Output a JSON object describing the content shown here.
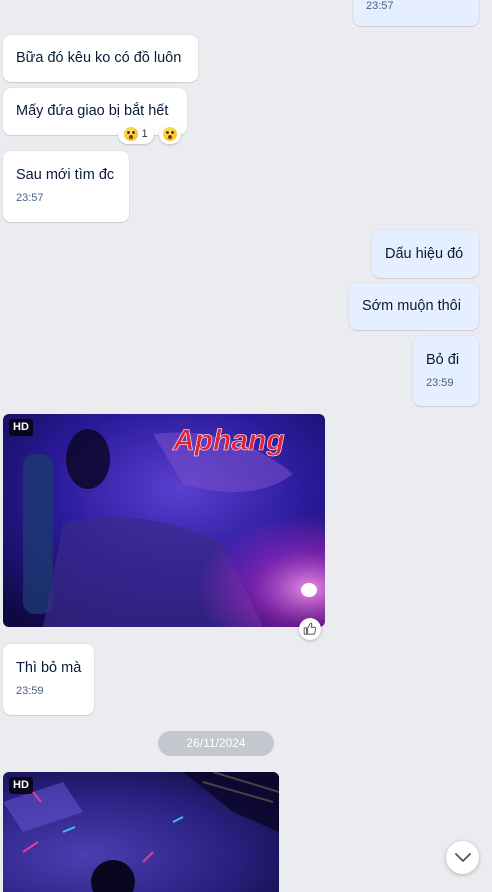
{
  "messages": {
    "m0": {
      "time": "23:57"
    },
    "m1": {
      "text": "Bữa đó kêu ko có đồ luôn"
    },
    "m2": {
      "text": "Mấy đứa giao bị bắt hết",
      "reaction_count": "1"
    },
    "m3": {
      "text": "Sau mới tìm đc",
      "time": "23:57"
    },
    "m4": {
      "text": "Dấu hiệu đó"
    },
    "m5": {
      "text": "Sớm muộn thôi"
    },
    "m6": {
      "text": "Bỏ đi",
      "time": "23:59"
    },
    "m7": {
      "badge": "HD",
      "watermark": "Aphang"
    },
    "m8": {
      "text": "Thì bỏ mà",
      "time": "23:59"
    },
    "m9": {
      "badge": "HD"
    }
  },
  "date_divider": "26/11/2024",
  "icons": {
    "reaction": "astonished-face-icon",
    "like": "thumbs-up-icon",
    "scroll": "chevron-down-icon"
  },
  "colors": {
    "incoming_bubble": "#ffffff",
    "outgoing_bubble": "#e5efff",
    "background": "#ebecf0",
    "date_pill": "#c4c8ce"
  }
}
